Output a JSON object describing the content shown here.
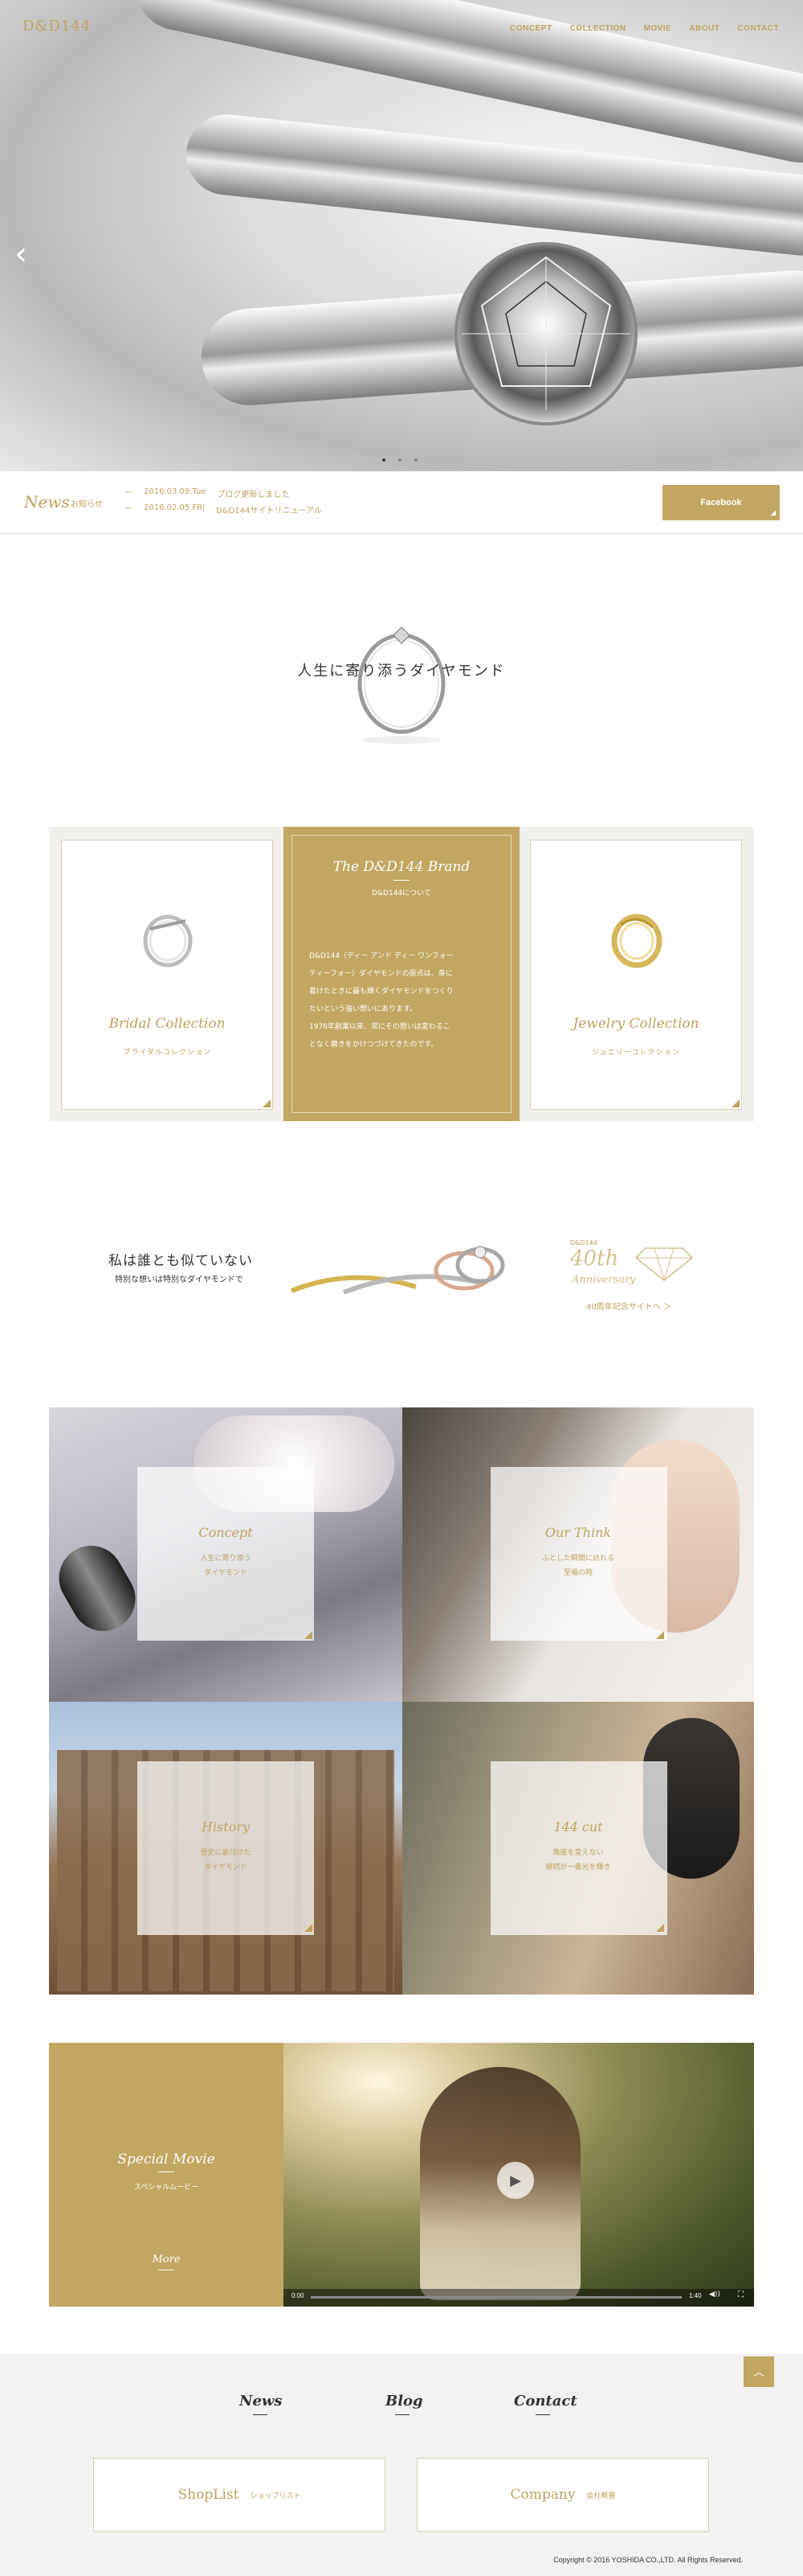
{
  "header": {
    "logo": "D&D144",
    "nav": [
      "CONCEPT",
      "COLLECTION",
      "MOVIE",
      "ABOUT",
      "CONTACT"
    ]
  },
  "hero": {
    "prev_icon": "chevron-left-icon",
    "slides": 3,
    "active_slide": 1
  },
  "news": {
    "title": "News",
    "subtitle": "お知らせ",
    "items": [
      {
        "date": "2016.03.09.Tue",
        "text": "ブログ更新しました"
      },
      {
        "date": "2016.02.05.FRI",
        "text": "D&D144サイトリニューアル"
      }
    ],
    "facebook_label": "Facebook"
  },
  "tagline": "人生に寄り添うダイヤモンド",
  "collection": {
    "bridal": {
      "title": "Bridal Collection",
      "subtitle": "ブライダルコレクション"
    },
    "brand": {
      "title": "The D&D144 Brand",
      "subtitle": "D&D144について",
      "lines": [
        "D&D144（ディー アンド ディー ワンフォー",
        "ティーフォー）ダイヤモンドの原点は、身に",
        "着けたときに最も輝くダイヤモンドをつくり",
        "たいという強い想いにあります。",
        "1976年創業以来、常にその想いは変わるこ",
        "となく磨きをかけつづけてきたのです。"
      ]
    },
    "jewelry": {
      "title": "Jewelry Collection",
      "subtitle": "ジュエリーコレクション"
    }
  },
  "banner": {
    "headline": "私は誰とも似ていない",
    "subline": "特別な想いは特別なダイヤモンドで",
    "anniv_small": "D&D144",
    "anniv_number": "40th",
    "anniv_label": "Anniversary",
    "anniv_link": "40周年記念サイトへ ＞"
  },
  "tiles": [
    {
      "title": "Concept",
      "lines": [
        "人生に寄り添う",
        "ダイヤモンド"
      ]
    },
    {
      "title": "Our Think",
      "lines": [
        "ふとした瞬間に訪れる",
        "至福の時"
      ]
    },
    {
      "title": "History",
      "lines": [
        "歴史に裏付けた",
        "ダイヤモンド"
      ]
    },
    {
      "title": "144 cut",
      "lines": [
        "角度を変えない",
        "継続が一番光を輝き"
      ]
    }
  ],
  "movie": {
    "title": "Special Movie",
    "subtitle": "スペシャルムービー",
    "more": "More",
    "time_current": "0:00",
    "time_total": "1:40",
    "progress": 0.0
  },
  "footer": {
    "links": [
      "News",
      "Blog",
      "Contact"
    ],
    "shoplist": {
      "title": "ShopList",
      "sub": "ショップリスト"
    },
    "company": {
      "title": "Company",
      "sub": "会社概要"
    },
    "copyright": "Copyright © 2016 YOSHIDA CO.,LTD. All Rights Reserved.",
    "to_top_icon": "chevron-up-icon"
  },
  "colors": {
    "accent": "#c2a661",
    "accent_text": "#bfa35e",
    "footer_bg": "#f2f2f2"
  }
}
